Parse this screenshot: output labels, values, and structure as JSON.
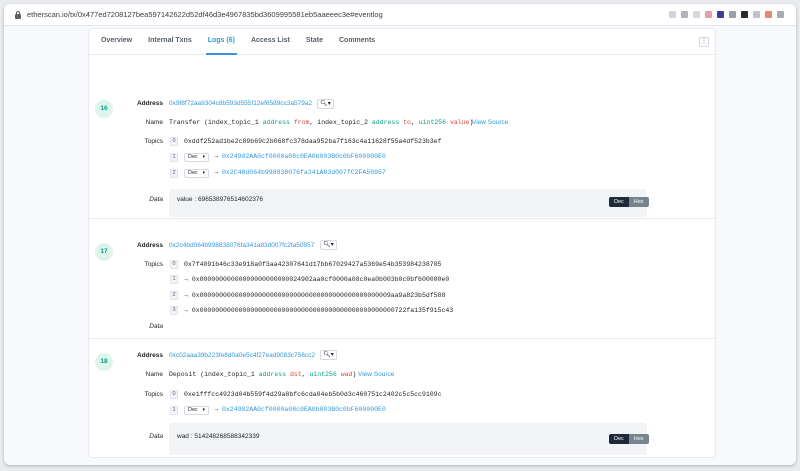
{
  "browser": {
    "url": "etherscan.io/tx/0x477ed7208127bea597142622d52df46d3e4967835bd3609995581eb5aaeeec3e#eventlog",
    "ext_colors": [
      "#d0d3d8",
      "#b0b4ba",
      "#e8a0a8",
      "#3c3c96",
      "#9ca0a6",
      "#d5d8dc",
      "#2c2c2c",
      "#bfc2c6",
      "#e08a78",
      "#a8acb2"
    ]
  },
  "tabs": [
    {
      "label": "Overview"
    },
    {
      "label": "Internal Txns"
    },
    {
      "label": "Logs (6)"
    },
    {
      "label": "Access List"
    },
    {
      "label": "State"
    },
    {
      "label": "Comments"
    }
  ],
  "labels": {
    "address": "Address",
    "name": "Name",
    "topics": "Topics",
    "data": "Data"
  },
  "logs": [
    {
      "index": "16",
      "address": "0x9f8f72aa9304c8b593d555f12ef6589cc3a579a2",
      "name": {
        "fn": "Transfer",
        "p1": "index_topic_1",
        "t1": "address",
        "n1": "from",
        "p2": "index_topic_2",
        "t2": "address",
        "n2": "to",
        "t3": "uint256",
        "n3": "value",
        "view_source": "View Source"
      },
      "topics": [
        {
          "i": "0",
          "value": "0xddf252ad1be2c89b69c2b068fc378daa952ba7f163c4a11628f55a4df523b3ef"
        },
        {
          "i": "1",
          "sel": "Dec",
          "arrow": "→",
          "value": "0x24902AA0cf0000a08c0EA0b003B0c0bF600000E0"
        },
        {
          "i": "2",
          "sel": "Dec",
          "arrow": "→",
          "value": "0x2C48d064b998838076fa341A83d007fC2FA50957"
        }
      ],
      "data": {
        "key": "value",
        "value": "696538976514602376",
        "dec": "Dec",
        "hex": "Hex"
      }
    },
    {
      "index": "17",
      "address": "0x2c4bd064b998838076fa341a83d007fc2fa50957",
      "topics": [
        {
          "i": "0",
          "value": "0x7f4091b46c33e918a0f3aa42307641d17bb67029427a5369e54b353984238705"
        },
        {
          "i": "1",
          "arrow": "→",
          "value": "0x00000000000000000000000024902aa0cf0000a08c0ea0b003b0c0bf600000e0"
        },
        {
          "i": "2",
          "arrow": "→",
          "value": "0x0000000000000000000000000000000000000000000000009aa9a823b5df588"
        },
        {
          "i": "3",
          "arrow": "→",
          "value": "0x00000000000000000000000000000000000000000000000000722fa135f915c43"
        }
      ]
    },
    {
      "index": "18",
      "address": "0xc02aaa39b223fe8d0a0e5c4f27ead9083c756cc2",
      "name": {
        "fn": "Deposit",
        "p1": "index_topic_1",
        "t1": "address",
        "n1": "dst",
        "t2": "uint256",
        "n2": "wad",
        "view_source": "View Source"
      },
      "topics": [
        {
          "i": "0",
          "value": "0xe1fffcc4923d04b559f4d29a8bfc6cda04eb5b0d3c460751c2402c5c5cc9109c"
        },
        {
          "i": "1",
          "sel": "Dec",
          "arrow": "→",
          "value": "0x24902AA0cf0000a08c0EA0b003B0c0bF600000E0"
        }
      ],
      "data": {
        "key": "wad",
        "value": "514248268588342339",
        "dec": "Dec",
        "hex": "Hex"
      }
    }
  ],
  "colors": {
    "accent": "#3498db",
    "badge_bg": "#dff5ec",
    "badge_fg": "#00a186"
  }
}
